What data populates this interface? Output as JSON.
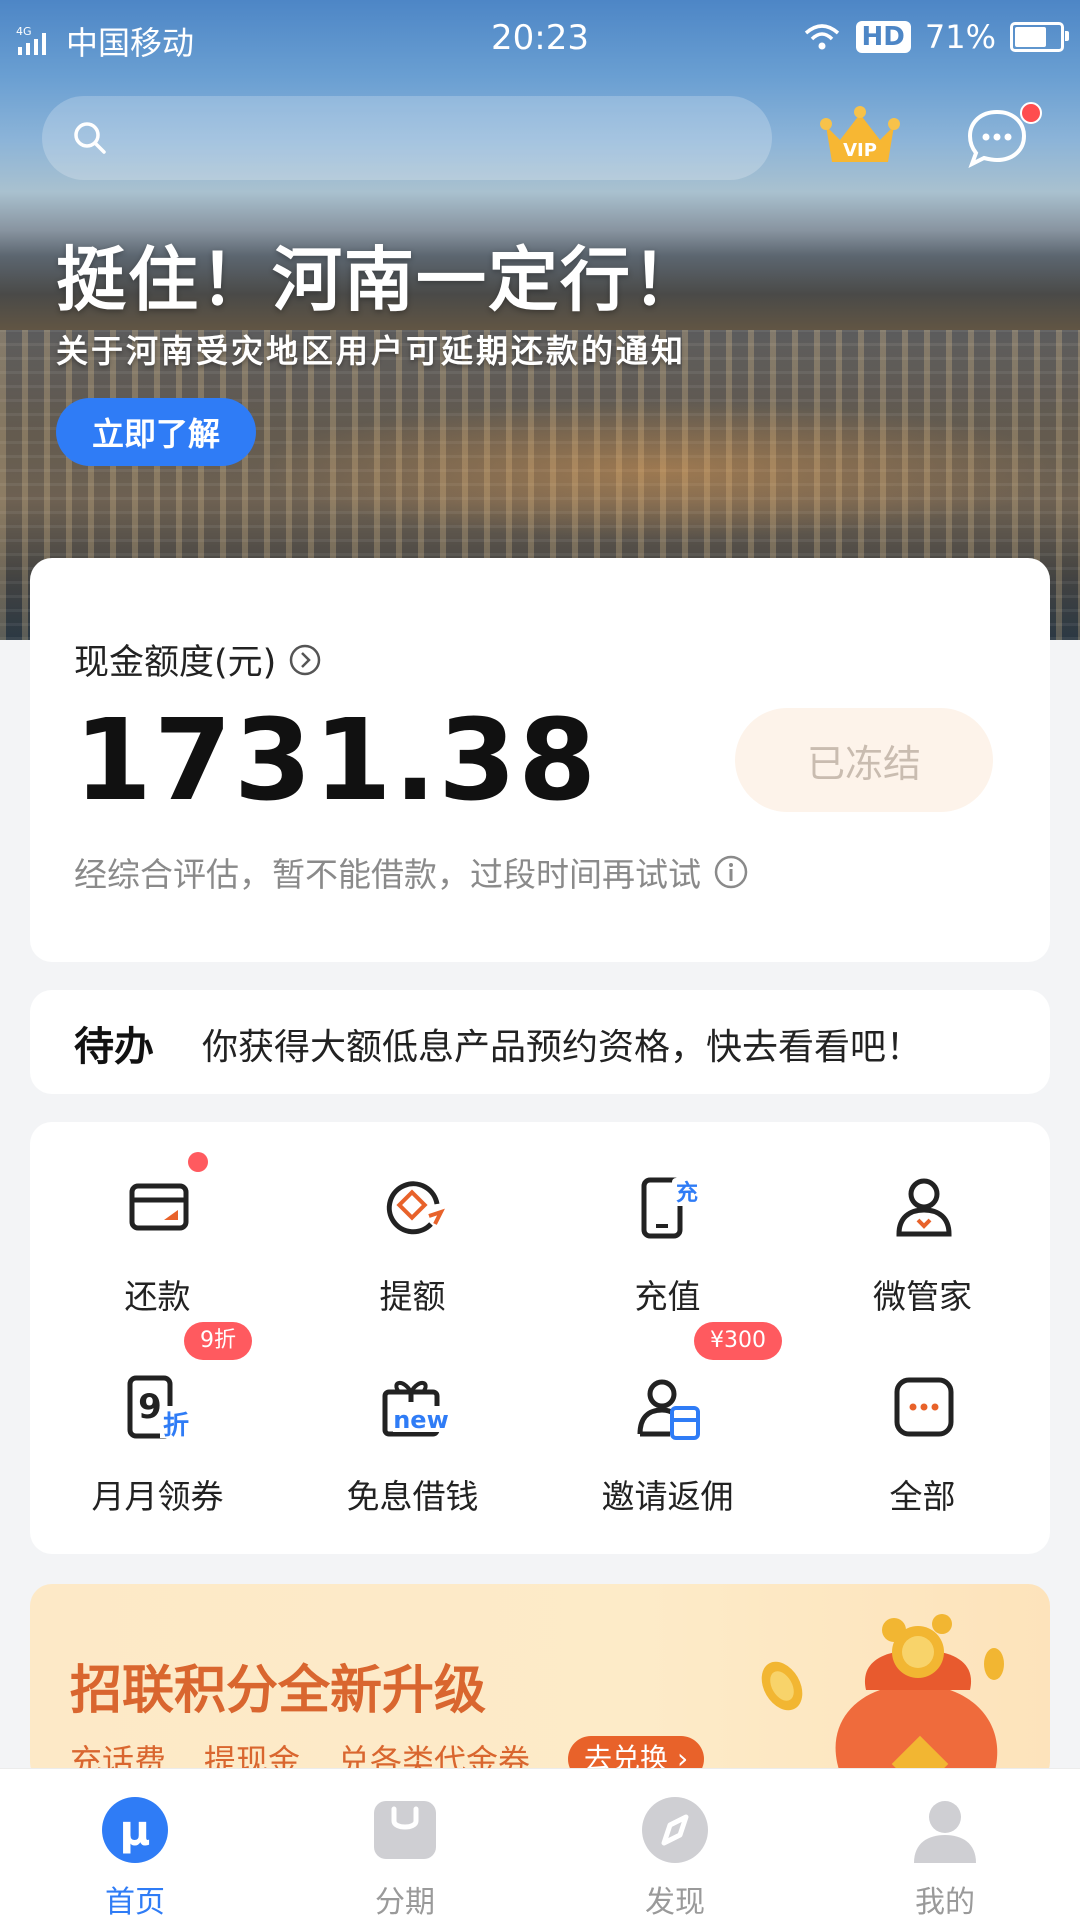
{
  "status_bar": {
    "network": "4G",
    "carrier": "中国移动",
    "time": "20:23",
    "hd": "HD",
    "battery": "71%",
    "battery_level": 0.71
  },
  "header": {
    "search_placeholder": "",
    "vip_label": "VIP",
    "message_unread": true
  },
  "banner": {
    "title": "挺住！河南一定行！",
    "subtitle": "关于河南受灾地区用户可延期还款的通知",
    "button": "立即了解"
  },
  "credit": {
    "label": "现金额度(元)",
    "amount": "1731.38",
    "status_button": "已冻结",
    "note": "经综合评估，暂不能借款，过段时间再试试"
  },
  "todo": {
    "label": "待办",
    "text": "你获得大额低息产品预约资格，快去看看吧！"
  },
  "services": [
    {
      "label": "还款",
      "icon": "repay-icon",
      "badge": "",
      "dot": true
    },
    {
      "label": "提额",
      "icon": "raise-limit-icon",
      "badge": "",
      "dot": false
    },
    {
      "label": "充值",
      "icon": "recharge-icon",
      "badge": "",
      "dot": false
    },
    {
      "label": "微管家",
      "icon": "butler-icon",
      "badge": "",
      "dot": false
    },
    {
      "label": "月月领券",
      "icon": "monthly-coupon-icon",
      "badge": "9折",
      "dot": false
    },
    {
      "label": "免息借钱",
      "icon": "interest-free-icon",
      "badge": "",
      "dot": false
    },
    {
      "label": "邀请返佣",
      "icon": "invite-icon",
      "badge": "¥300",
      "dot": false
    },
    {
      "label": "全部",
      "icon": "more-icon",
      "badge": "",
      "dot": false
    }
  ],
  "promo": {
    "title": "招联积分全新升级",
    "items": [
      "充话费",
      "提现金",
      "兑各类代金券"
    ],
    "button": "去兑换 ›"
  },
  "tabs": [
    {
      "label": "首页",
      "icon": "home-icon",
      "active": true
    },
    {
      "label": "分期",
      "icon": "installment-icon",
      "active": false
    },
    {
      "label": "发现",
      "icon": "discover-icon",
      "active": false
    },
    {
      "label": "我的",
      "icon": "profile-icon",
      "active": false
    }
  ],
  "colors": {
    "accent": "#2f7cf6",
    "badge_red": "#ff5a5f",
    "promo_orange": "#d9662f"
  }
}
